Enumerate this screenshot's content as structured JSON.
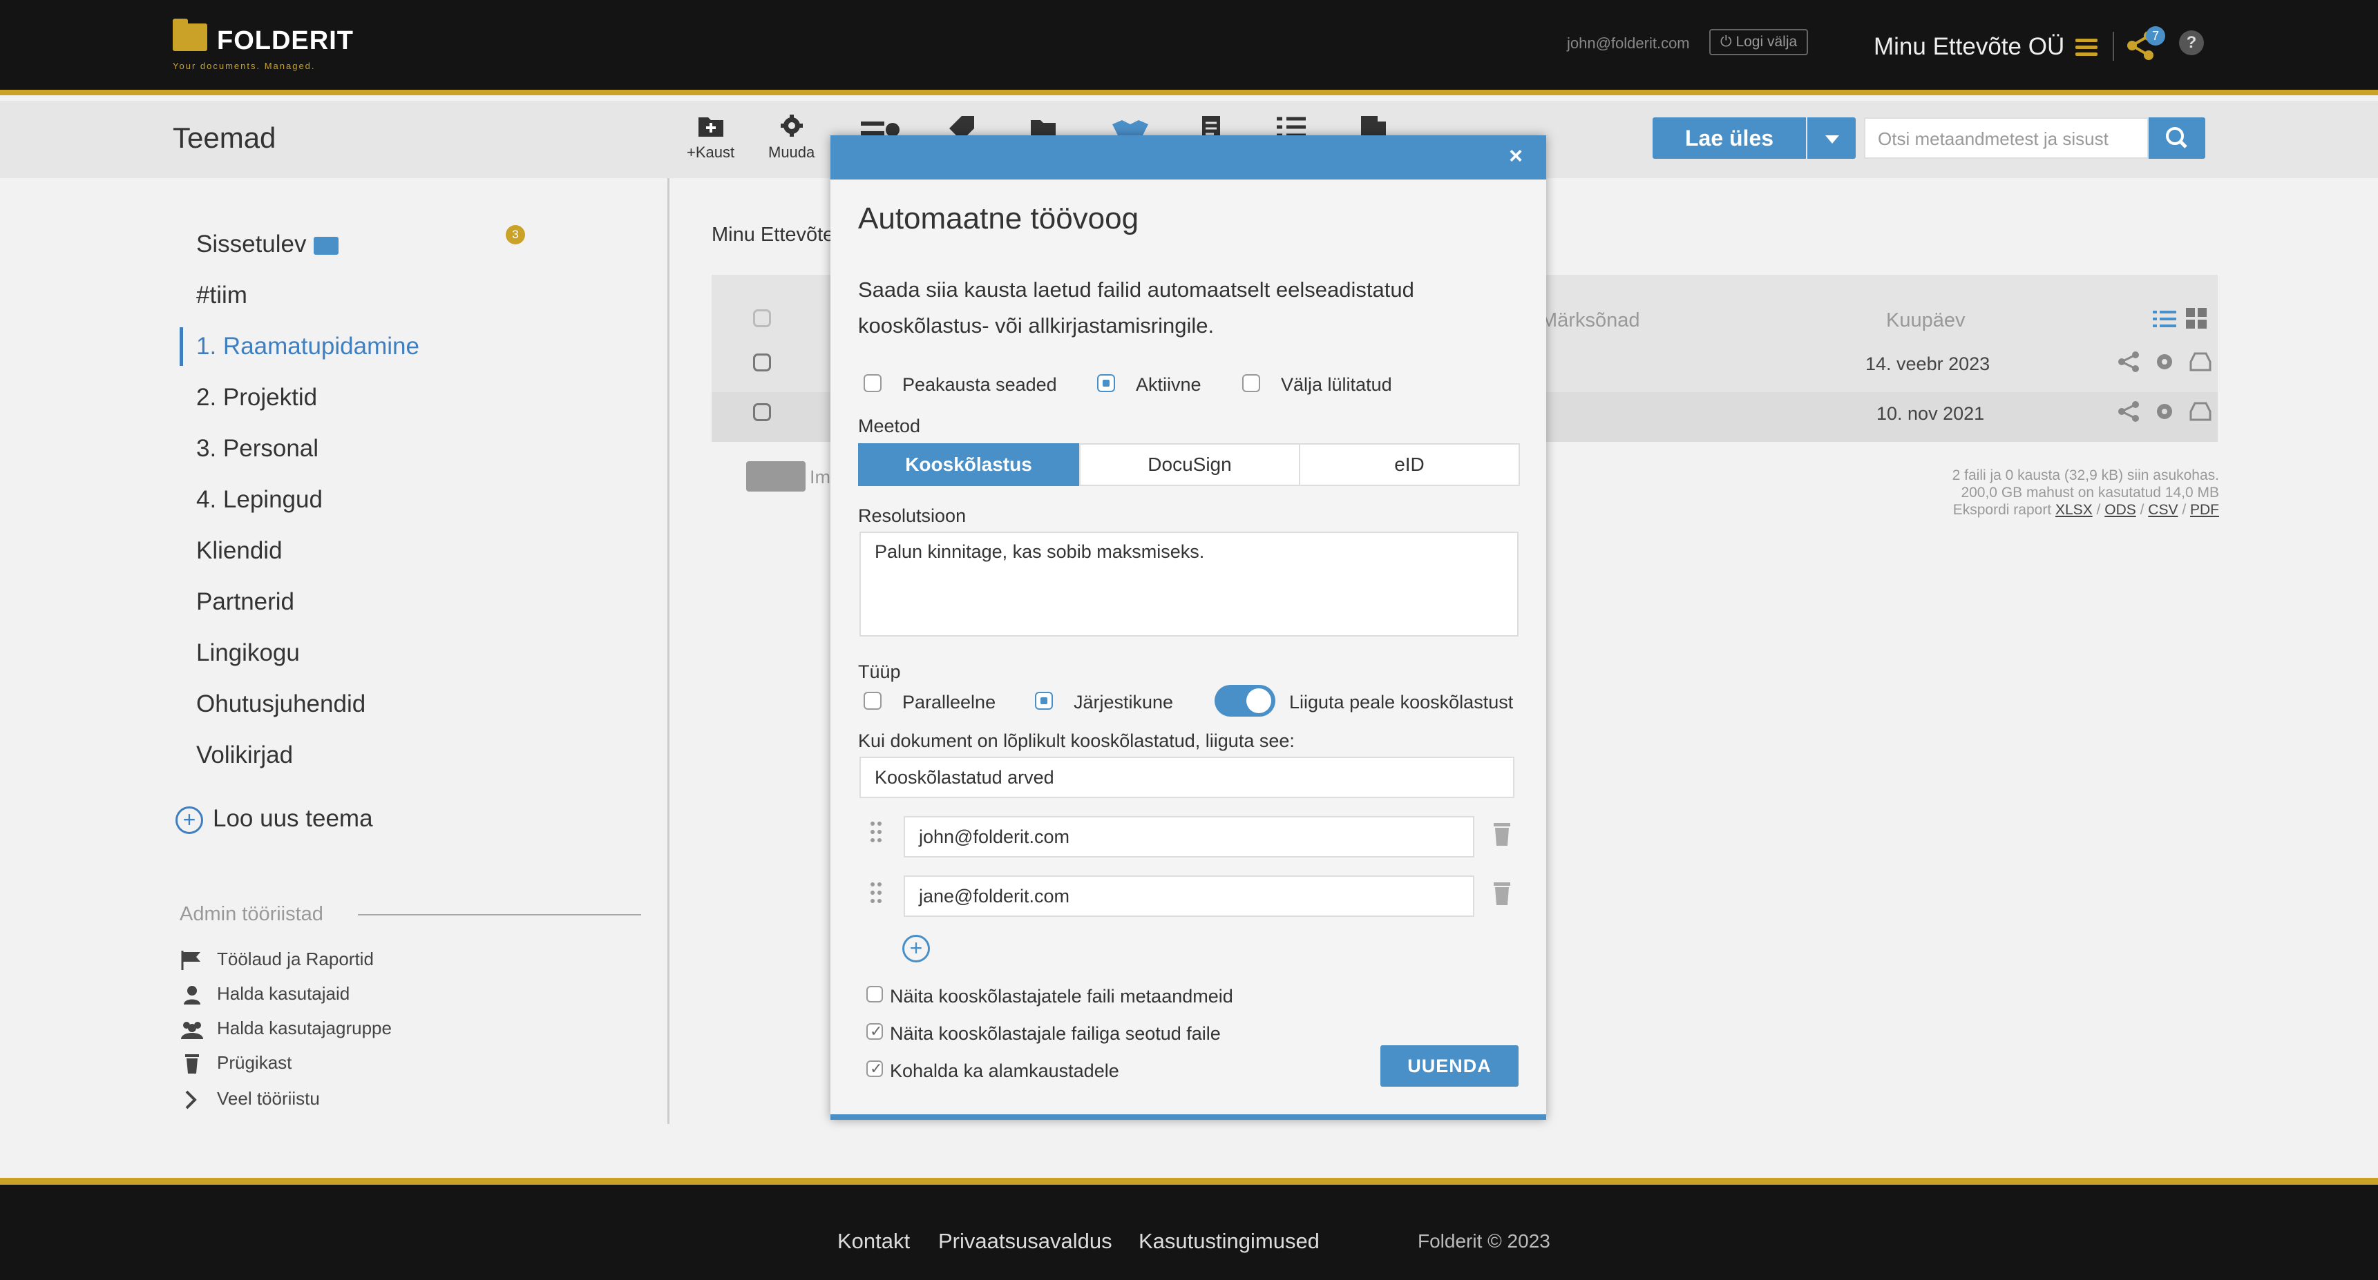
{
  "header": {
    "logo_name": "FOLDERIT",
    "logo_tagline": "Your documents. Managed.",
    "user_email": "john@folderit.com",
    "logout_label": "Logi välja",
    "company": "Minu Ettevõte OÜ",
    "share_badge": "7",
    "help": "?"
  },
  "toolbar": {
    "page_title": "Teemad",
    "new_folder": "+Kaust",
    "edit": "Muuda",
    "upload": "Lae üles",
    "search_placeholder": "Otsi metaandmetest ja sisust"
  },
  "sidebar": {
    "inbox_badge": "3",
    "items": [
      {
        "label": "Sissetulev"
      },
      {
        "label": "#tiim"
      },
      {
        "label": "1. Raamatupidamine"
      },
      {
        "label": "2. Projektid"
      },
      {
        "label": "3. Personal"
      },
      {
        "label": "4. Lepingud"
      },
      {
        "label": "Kliendid"
      },
      {
        "label": "Partnerid"
      },
      {
        "label": "Lingikogu"
      },
      {
        "label": "Ohutusjuhendid"
      },
      {
        "label": "Volikirjad"
      }
    ],
    "new_theme": "Loo uus teema",
    "admin_title": "Admin tööriistad",
    "admin_items": [
      {
        "label": "Töölaud ja Raportid",
        "icon": "flag-icon"
      },
      {
        "label": "Halda kasutajaid",
        "icon": "user-icon"
      },
      {
        "label": "Halda kasutajagruppe",
        "icon": "users-icon"
      },
      {
        "label": "Prügikast",
        "icon": "trash-icon"
      },
      {
        "label": "Veel tööriistu",
        "icon": "chevron-right-icon"
      }
    ]
  },
  "content": {
    "breadcrumb": "Minu Ettevõte",
    "col_keywords": "Märksõnad",
    "col_date": "Kuupäev",
    "rows": [
      {
        "date": "14. veebr 2023"
      },
      {
        "date": "10. nov 2021"
      }
    ],
    "invite_text": "Im",
    "summary_line1": "2 faili ja 0 kausta (32,9 kB) siin asukohas.",
    "summary_line2": "200,0 GB mahust on kasutatud 14,0 MB",
    "summary_export": "Ekspordi raport",
    "export_xlsx": "XLSX",
    "export_ods": "ODS",
    "export_csv": "CSV",
    "export_pdf": "PDF",
    "sep": "/"
  },
  "modal": {
    "close": "×",
    "title": "Automaatne töövoog",
    "description": "Saada siia kausta laetud failid automaatselt eelseadistatud kooskõlastus- või allkirjastamisringile.",
    "status_options": [
      "Peakausta seaded",
      "Aktiivne",
      "Välja lülitatud"
    ],
    "status_selected": "Aktiivne",
    "method_label": "Meetod",
    "methods": [
      "Kooskõlastus",
      "DocuSign",
      "eID"
    ],
    "method_selected": "Kooskõlastus",
    "resolution_label": "Resolutsioon",
    "resolution_value": "Palun kinnitage, kas sobib maksmiseks.",
    "type_label": "Tüüp",
    "type_options": [
      "Paralleelne",
      "Järjestikune"
    ],
    "type_selected": "Järjestikune",
    "move_toggle_label": "Liiguta peale kooskõlastust",
    "move_toggle_on": true,
    "move_to_label": "Kui dokument on lõplikult kooskõlastatud, liiguta see:",
    "move_to_value": "Kooskõlastatud arved",
    "approvers": [
      "john@folderit.com",
      "jane@folderit.com"
    ],
    "options": [
      {
        "label": "Näita kooskõlastajatele faili metaandmeid",
        "checked": false
      },
      {
        "label": "Näita kooskõlastajale failiga seotud faile",
        "checked": true
      },
      {
        "label": "Kohalda ka alamkaustadele",
        "checked": true
      }
    ],
    "update_button": "UUENDA"
  },
  "footer": {
    "contact": "Kontakt",
    "privacy": "Privaatsusavaldus",
    "terms": "Kasutustingimused",
    "copyright": "Folderit © 2023"
  },
  "colors": {
    "accent": "#4a90c8",
    "gold": "#c9a227",
    "dark": "#141414"
  }
}
